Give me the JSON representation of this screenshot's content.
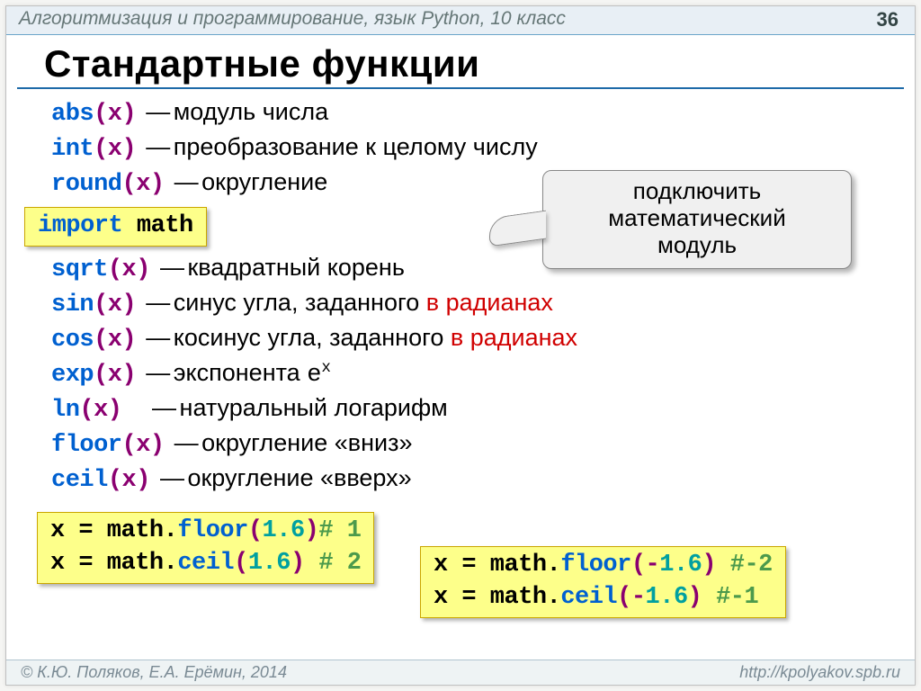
{
  "header": {
    "course": "Алгоритмизация и программирование, язык Python, 10 класс",
    "page": "36"
  },
  "title": "Стандартные функции",
  "f": {
    "abs": {
      "fn": "abs",
      "arg": "(x)",
      "desc": "модуль числа"
    },
    "int": {
      "fn": "int",
      "arg": "(x)",
      "desc": "преобразование к целому числу"
    },
    "round": {
      "fn": "round",
      "arg": "(x)",
      "desc": "округление"
    },
    "import": {
      "kw": "import",
      "mod": " math"
    },
    "sqrt": {
      "fn": "sqrt",
      "arg": "(x)",
      "desc": "квадратный корень"
    },
    "sin": {
      "fn": "sin",
      "arg": "(x)",
      "d1": "синус угла, заданного ",
      "rad": "в радианах"
    },
    "cos": {
      "fn": "cos",
      "arg": "(x)",
      "d1": "косинус угла, заданного ",
      "rad": "в радианах"
    },
    "exp": {
      "fn": "exp",
      "arg": "(x)",
      "d1": "экспонента ",
      "e": "e",
      "sup": "x"
    },
    "ln": {
      "fn": "ln",
      "arg": "(x)",
      "desc": "натуральный логарифм"
    },
    "floor": {
      "fn": "floor",
      "arg": "(x)",
      "desc": "округление «вниз»"
    },
    "ceil": {
      "fn": "ceil",
      "arg": "(x)",
      "desc": "округление «вверх»"
    }
  },
  "callout": {
    "l1": "подключить",
    "l2": "математический",
    "l3": "модуль"
  },
  "ex1": {
    "a_pre": "x = math.",
    "a_fn": "floor",
    "a_par": "(",
    "a_num": "1.6",
    "a_par2": ")",
    "a_cmt": "# 1",
    "b_pre": "x = math.",
    "b_fn": "ceil",
    "b_par": "(",
    "b_num": "1.6",
    "b_par2": ") ",
    "b_cmt": "# 2"
  },
  "ex2": {
    "a_pre": "x = math.",
    "a_fn": "floor",
    "a_par": "(-",
    "a_num": "1.6",
    "a_par2": ") ",
    "a_cmt": "#-2",
    "b_pre": "x = math.",
    "b_fn": "ceil",
    "b_par": "(-",
    "b_num": "1.6",
    "b_par2": ")  ",
    "b_cmt": "#-1"
  },
  "footer": {
    "left": "© К.Ю. Поляков, Е.А. Ерёмин, 2014",
    "right": "http://kpolyakov.spb.ru"
  },
  "dash": "—"
}
